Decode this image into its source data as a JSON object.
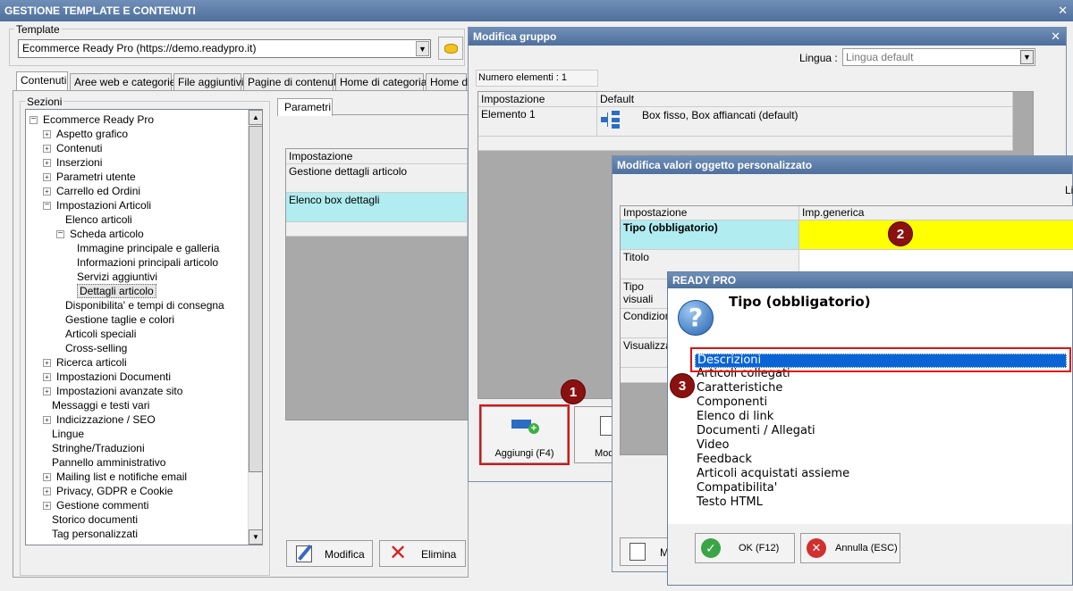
{
  "main_window": {
    "title": "GESTIONE TEMPLATE E CONTENUTI",
    "template_label": "Template",
    "template_value": "Ecommerce Ready Pro (https://demo.readypro.it)",
    "tabs": [
      "Contenuti",
      "Aree web e categorie",
      "File aggiuntivi",
      "Pagine di contenuti",
      "Home di categoria",
      "Home di"
    ],
    "sections_label": "Sezioni",
    "tree": [
      {
        "label": "Ecommerce Ready Pro",
        "level": 0,
        "expander": "minus"
      },
      {
        "label": "Aspetto grafico",
        "level": 1,
        "expander": "plus"
      },
      {
        "label": "Contenuti",
        "level": 1,
        "expander": "plus"
      },
      {
        "label": "Inserzioni",
        "level": 1,
        "expander": "plus"
      },
      {
        "label": "Parametri utente",
        "level": 1,
        "expander": "plus"
      },
      {
        "label": "Carrello ed Ordini",
        "level": 1,
        "expander": "plus"
      },
      {
        "label": "Impostazioni Articoli",
        "level": 1,
        "expander": "minus"
      },
      {
        "label": "Elenco articoli",
        "level": 2,
        "expander": "none"
      },
      {
        "label": "Scheda articolo",
        "level": 2,
        "expander": "minus"
      },
      {
        "label": "Immagine principale e galleria",
        "level": 3,
        "expander": "none"
      },
      {
        "label": "Informazioni principali articolo",
        "level": 3,
        "expander": "none"
      },
      {
        "label": "Servizi aggiuntivi",
        "level": 3,
        "expander": "none"
      },
      {
        "label": "Dettagli articolo",
        "level": 3,
        "expander": "none",
        "selected": true
      },
      {
        "label": "Disponibilita' e tempi di consegna",
        "level": 2,
        "expander": "none"
      },
      {
        "label": "Gestione taglie e colori",
        "level": 2,
        "expander": "none"
      },
      {
        "label": "Articoli speciali",
        "level": 2,
        "expander": "none"
      },
      {
        "label": "Cross-selling",
        "level": 2,
        "expander": "none"
      },
      {
        "label": "Ricerca articoli",
        "level": 1,
        "expander": "plus"
      },
      {
        "label": "Impostazioni Documenti",
        "level": 1,
        "expander": "plus"
      },
      {
        "label": "Impostazioni avanzate sito",
        "level": 1,
        "expander": "plus"
      },
      {
        "label": "Messaggi e testi vari",
        "level": 1,
        "expander": "none"
      },
      {
        "label": "Indicizzazione / SEO",
        "level": 1,
        "expander": "plus"
      },
      {
        "label": "Lingue",
        "level": 1,
        "expander": "none"
      },
      {
        "label": "Stringhe/Traduzioni",
        "level": 1,
        "expander": "none"
      },
      {
        "label": "Pannello amministrativo",
        "level": 1,
        "expander": "none"
      },
      {
        "label": "Mailing list e notifiche email",
        "level": 1,
        "expander": "plus"
      },
      {
        "label": "Privacy, GDPR e Cookie",
        "level": 1,
        "expander": "plus"
      },
      {
        "label": "Gestione commenti",
        "level": 1,
        "expander": "plus"
      },
      {
        "label": "Storico documenti",
        "level": 1,
        "expander": "none"
      },
      {
        "label": "Tag personalizzati",
        "level": 1,
        "expander": "none"
      }
    ],
    "params_tab": "Parametri",
    "params_grid": {
      "header": "Impostazione",
      "rows": [
        "Gestione dettagli articolo",
        "Elenco box dettagli"
      ]
    },
    "modifica_label": "Modifica",
    "elimina_label": "Elimina"
  },
  "group_window": {
    "title": "Modifica gruppo",
    "lingua_label": "Lingua :",
    "lingua_value": "Lingua default",
    "count_label": "Numero elementi : 1",
    "grid_headers": [
      "Impostazione",
      "Default"
    ],
    "row_name": "Elemento 1",
    "row_value": "Box fisso, Box affiancati (default)",
    "add_label": "Aggiungi (F4)",
    "mod_label": "Mod"
  },
  "custom_window": {
    "title": "Modifica valori oggetto personalizzato",
    "lingua_short": "Lin",
    "grid_headers": [
      "Impostazione",
      "Imp.generica"
    ],
    "rows": [
      "Tipo (obbligatorio)",
      "Titolo",
      "Tipo visuali",
      "Condizione",
      "Visualizza"
    ],
    "mod_label": "M"
  },
  "dialog": {
    "title": "READY PRO",
    "question": "Tipo (obbligatorio)",
    "options": [
      "Descrizioni",
      "Articoli collegati",
      "Caratteristiche",
      "Componenti",
      "Elenco di link",
      "Documenti / Allegati",
      "Video",
      "Feedback",
      "Articoli acquistati assieme",
      "Compatibilita'",
      "Testo HTML"
    ],
    "selected_index": 0,
    "ok_label": "OK (F12)",
    "cancel_label": "Annulla (ESC)"
  },
  "badges": [
    "1",
    "2",
    "3"
  ],
  "colors": {
    "title_bar": "#5a7aa8",
    "selection_cyan": "#b0ecf0",
    "highlight_yellow": "#ffff00",
    "list_select": "#0a64d6",
    "annotation_red": "#e01010",
    "badge": "#8b1111"
  }
}
